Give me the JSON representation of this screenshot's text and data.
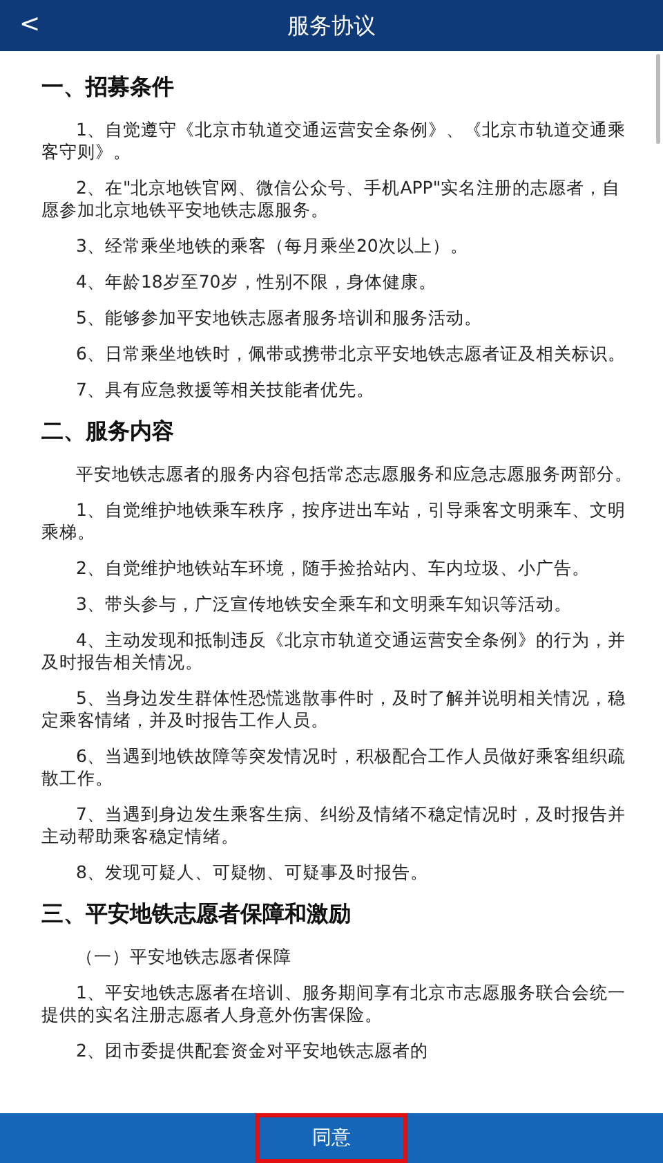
{
  "header": {
    "back": "<",
    "title": "服务协议"
  },
  "sections": [
    {
      "heading": "一、招募条件",
      "paragraphs": [
        "1、自觉遵守《北京市轨道交通运营安全条例》、《北京市轨道交通乘客守则》。",
        "2、在\"北京地铁官网、微信公众号、手机APP\"实名注册的志愿者，自愿参加北京地铁平安地铁志愿服务。",
        "3、经常乘坐地铁的乘客（每月乘坐20次以上）。",
        "4、年龄18岁至70岁，性别不限，身体健康。",
        "5、能够参加平安地铁志愿者服务培训和服务活动。",
        "6、日常乘坐地铁时，佩带或携带北京平安地铁志愿者证及相关标识。",
        "7、具有应急救援等相关技能者优先。"
      ]
    },
    {
      "heading": "二、服务内容",
      "paragraphs": [
        "平安地铁志愿者的服务内容包括常态志愿服务和应急志愿服务两部分。",
        "1、自觉维护地铁乘车秩序，按序进出车站，引导乘客文明乘车、文明乘梯。",
        "2、自觉维护地铁站车环境，随手捡拾站内、车内垃圾、小广告。",
        "3、带头参与，广泛宣传地铁安全乘车和文明乘车知识等活动。",
        "4、主动发现和抵制违反《北京市轨道交通运营安全条例》的行为，并及时报告相关情况。",
        "5、当身边发生群体性恐慌逃散事件时，及时了解并说明相关情况，稳定乘客情绪，并及时报告工作人员。",
        "6、当遇到地铁故障等突发情况时，积极配合工作人员做好乘客组织疏散工作。",
        "7、当遇到身边发生乘客生病、纠纷及情绪不稳定情况时，及时报告并主动帮助乘客稳定情绪。",
        "8、发现可疑人、可疑物、可疑事及时报告。"
      ]
    },
    {
      "heading": "三、平安地铁志愿者保障和激励",
      "paragraphs": [
        "（一）平安地铁志愿者保障",
        "1、平安地铁志愿者在培训、服务期间享有北京市志愿服务联合会统一提供的实名注册志愿者人身意外伤害保险。",
        "2、团市委提供配套资金对平安地铁志愿者的"
      ]
    }
  ],
  "agree_button": "同意"
}
